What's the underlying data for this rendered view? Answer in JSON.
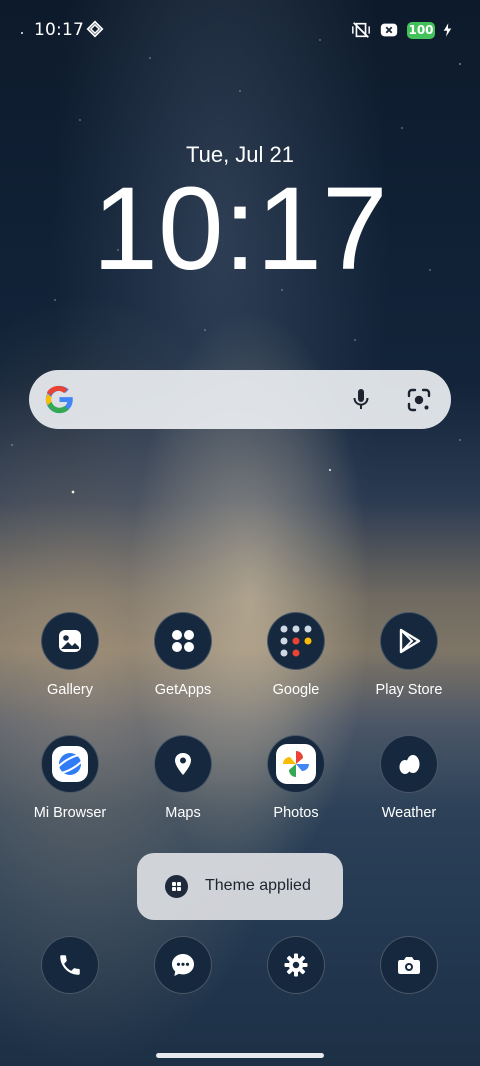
{
  "status_bar": {
    "time": "10:17",
    "battery_level": "100",
    "icons": [
      "grid-diamond-icon",
      "vibrate-off-icon",
      "notification-x-icon",
      "battery-icon",
      "charging-bolt-icon"
    ]
  },
  "lockscreen": {
    "date": "Tue, Jul 21",
    "time": "10:17"
  },
  "search_bar": {
    "icons": [
      "google-logo-icon",
      "microphone-icon",
      "lens-icon"
    ]
  },
  "apps_row1": [
    {
      "label": "Gallery",
      "icon": "gallery-icon"
    },
    {
      "label": "GetApps",
      "icon": "getapps-icon"
    },
    {
      "label": "Google",
      "icon": "folder-icon"
    },
    {
      "label": "Play Store",
      "icon": "play-store-icon"
    }
  ],
  "apps_row2": [
    {
      "label": "Mi Browser",
      "icon": "browser-icon"
    },
    {
      "label": "Maps",
      "icon": "maps-icon"
    },
    {
      "label": "Photos",
      "icon": "photos-icon"
    },
    {
      "label": "Weather",
      "icon": "weather-icon"
    }
  ],
  "toast": {
    "text": "Theme applied",
    "icon": "theme-icon"
  },
  "dock": [
    {
      "name": "phone",
      "icon": "phone-icon"
    },
    {
      "name": "messages",
      "icon": "message-icon"
    },
    {
      "name": "settings",
      "icon": "settings-icon"
    },
    {
      "name": "camera",
      "icon": "camera-icon"
    }
  ],
  "colors": {
    "accent": "#42c35a",
    "icon_bg": "#16283d"
  }
}
